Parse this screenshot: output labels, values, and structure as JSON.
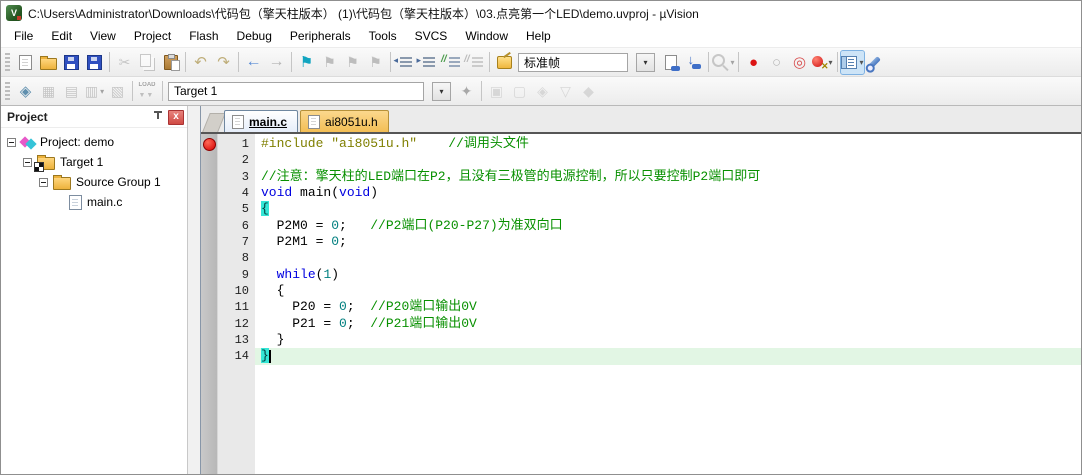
{
  "title_bar": {
    "title": "C:\\Users\\Administrator\\Downloads\\代码包（擎天柱版本） (1)\\代码包（擎天柱版本）\\03.点亮第一个LED\\demo.uvproj - µVision",
    "app_icon": "uvision-logo",
    "app_icon_text": "V"
  },
  "menu": {
    "items": [
      "File",
      "Edit",
      "View",
      "Project",
      "Flash",
      "Debug",
      "Peripherals",
      "Tools",
      "SVCS",
      "Window",
      "Help"
    ]
  },
  "colors": {
    "keyword": "#0000e0",
    "comment": "#089000",
    "preprocessor": "#7f7f00",
    "number": "#007f7f",
    "brace_match_bg": "#35e6d6",
    "current_line_bg": "#e2f6e4",
    "breakpoint_red": "#d40000",
    "inactive_tab_bg": "#f3be55"
  },
  "toolbar1": {
    "search_combo_value": "标准帧",
    "items": [
      {
        "k": "grip",
        "name": "toolbar-grip"
      },
      {
        "k": "btn",
        "name": "new-file-button",
        "shape": "page"
      },
      {
        "k": "btn",
        "name": "open-file-button",
        "shape": "folder"
      },
      {
        "k": "btn",
        "name": "save-button",
        "shape": "floppy"
      },
      {
        "k": "btn",
        "name": "save-all-button",
        "shape": "floppy floppy2"
      },
      {
        "k": "sep"
      },
      {
        "k": "btn",
        "name": "cut-button",
        "glyph": "✂",
        "color": "#9a9a9a",
        "dim": true
      },
      {
        "k": "btn",
        "name": "copy-button",
        "shape": "copy",
        "dim": true
      },
      {
        "k": "btn",
        "name": "paste-button",
        "shape": "paste"
      },
      {
        "k": "sep"
      },
      {
        "k": "btn",
        "name": "undo-button",
        "glyph": "↶",
        "color": "#bfae7a",
        "fs": 15
      },
      {
        "k": "btn",
        "name": "redo-button",
        "glyph": "↷",
        "color": "#bfae7a",
        "fs": 15
      },
      {
        "k": "sep"
      },
      {
        "k": "btn",
        "name": "navigate-back-button",
        "glyph": "←",
        "color": "#5b8dd6",
        "fs": 16
      },
      {
        "k": "btn",
        "name": "navigate-forward-button",
        "glyph": "→",
        "color": "#b5b5b5",
        "fs": 16
      },
      {
        "k": "sep"
      },
      {
        "k": "btn",
        "name": "toggle-bookmark-button",
        "glyph": "⚑",
        "color": "#12a5c0",
        "fs": 15
      },
      {
        "k": "btn",
        "name": "prev-bookmark-button",
        "glyph": "⚑",
        "color": "#bdbdbd",
        "fs": 14
      },
      {
        "k": "btn",
        "name": "next-bookmark-button",
        "glyph": "⚑",
        "color": "#bdbdbd",
        "fs": 14
      },
      {
        "k": "btn",
        "name": "clear-bookmarks-button",
        "glyph": "⚑",
        "color": "#bdbdbd",
        "fs": 14
      },
      {
        "k": "sep"
      },
      {
        "k": "btn",
        "name": "indent-button",
        "shape": "ind l"
      },
      {
        "k": "btn",
        "name": "outdent-button",
        "shape": "ind r"
      },
      {
        "k": "btn",
        "name": "comment-button",
        "shape": "com"
      },
      {
        "k": "btn",
        "name": "uncomment-button",
        "shape": "com",
        "dim": true
      },
      {
        "k": "sep"
      },
      {
        "k": "btn",
        "name": "find-settings-button",
        "shape": "findbox"
      },
      {
        "k": "combo",
        "name": "search-combobox",
        "cls": "search",
        "bind": "toolbar1.search_combo_value"
      },
      {
        "k": "arrow",
        "name": "search-combobox-dropdown"
      },
      {
        "k": "btn",
        "name": "find-in-files-button",
        "shape": "finddoc"
      },
      {
        "k": "btn",
        "name": "incremental-find-button",
        "shape": "incr"
      },
      {
        "k": "sep"
      },
      {
        "k": "btn",
        "name": "lookup-button",
        "shape": "mag",
        "dim": true,
        "arrow": true
      },
      {
        "k": "sep"
      },
      {
        "k": "btn",
        "name": "insert-breakpoint-button",
        "glyph": "●",
        "color": "#dc1414",
        "fs": 15
      },
      {
        "k": "btn",
        "name": "disable-breakpoint-button",
        "glyph": "○",
        "color": "#b8b8b8",
        "fs": 15
      },
      {
        "k": "btn",
        "name": "kill-breakpoint-button",
        "glyph": "◎",
        "color": "#d85050",
        "fs": 15
      },
      {
        "k": "btn",
        "name": "kill-all-breakpoints-button",
        "shape": "bpx",
        "arrow": true
      },
      {
        "k": "sep"
      },
      {
        "k": "btn",
        "name": "window-layout-button",
        "shape": "layout",
        "hl": true,
        "arrow": true
      },
      {
        "k": "btn",
        "name": "configure-button",
        "shape": "wrench"
      }
    ]
  },
  "toolbar2": {
    "target_combo_value": "Target 1",
    "items": [
      {
        "k": "grip",
        "name": "toolbar-grip"
      },
      {
        "k": "btn",
        "name": "translate-button",
        "glyph": "◈",
        "color": "#5f8fae",
        "fs": 15
      },
      {
        "k": "btn",
        "name": "build-button",
        "glyph": "▦",
        "color": "#9a9a9a",
        "dim": true,
        "fs": 14
      },
      {
        "k": "btn",
        "name": "rebuild-button",
        "glyph": "▤",
        "color": "#9a9a9a",
        "dim": true,
        "fs": 14
      },
      {
        "k": "btn",
        "name": "batch-build-button",
        "glyph": "▥",
        "color": "#9a9a9a",
        "dim": true,
        "fs": 14,
        "arrow": true
      },
      {
        "k": "btn",
        "name": "stop-build-button",
        "glyph": "▧",
        "color": "#9a9a9a",
        "dim": true,
        "fs": 14
      },
      {
        "k": "sep"
      },
      {
        "k": "btn",
        "name": "download-button",
        "shape": "load",
        "dim": true
      },
      {
        "k": "sep"
      },
      {
        "k": "combo",
        "name": "target-combobox",
        "cls": "target",
        "bind": "toolbar2.target_combo_value"
      },
      {
        "k": "arrow",
        "name": "target-combobox-dropdown"
      },
      {
        "k": "btn",
        "name": "target-options-button",
        "glyph": "✦",
        "color": "#a8a8a8",
        "fs": 14
      },
      {
        "k": "sep"
      },
      {
        "k": "btn",
        "name": "file-extensions-button",
        "glyph": "▣",
        "color": "#bdbdbd",
        "dim": true,
        "fs": 14
      },
      {
        "k": "btn",
        "name": "manage-windows-button",
        "glyph": "▢",
        "color": "#bdbdbd",
        "dim": true,
        "fs": 14
      },
      {
        "k": "btn",
        "name": "multi-project-button",
        "glyph": "◈",
        "color": "#bdbdbd",
        "dim": true,
        "fs": 14
      },
      {
        "k": "btn",
        "name": "funnel-button",
        "glyph": "▽",
        "color": "#bdbdbd",
        "dim": true,
        "fs": 14
      },
      {
        "k": "btn",
        "name": "pack-installer-button",
        "glyph": "◆",
        "color": "#bdbdbd",
        "dim": true,
        "fs": 14
      }
    ]
  },
  "project_panel": {
    "header": "Project",
    "tree": [
      {
        "label": "Project: demo",
        "level": 0,
        "icon": "chip",
        "expand": true
      },
      {
        "label": "Target 1",
        "level": 1,
        "icon": "folder-target",
        "expand": true
      },
      {
        "label": "Source Group 1",
        "level": 2,
        "icon": "folder",
        "expand": true
      },
      {
        "label": "main.c",
        "level": 3,
        "icon": "file",
        "expand": false
      }
    ]
  },
  "editor": {
    "tabs": [
      {
        "label": "main.c",
        "active": true
      },
      {
        "label": "ai8051u.h",
        "active": false
      }
    ],
    "lines": [
      {
        "n": 1,
        "bp": true,
        "seg": [
          [
            "pre",
            "#include"
          ],
          [
            "plain",
            " "
          ],
          [
            "str",
            "\"ai8051u.h\""
          ],
          [
            "plain",
            "    "
          ],
          [
            "com",
            "//调用头文件"
          ]
        ]
      },
      {
        "n": 2,
        "seg": []
      },
      {
        "n": 3,
        "seg": [
          [
            "com",
            "//注意：擎天柱的LED端口在P2，且没有三极管的电源控制，所以只要控制P2端口即可"
          ]
        ]
      },
      {
        "n": 4,
        "seg": [
          [
            "kw",
            "void"
          ],
          [
            "plain",
            " main("
          ],
          [
            "kw",
            "void"
          ],
          [
            "plain",
            ")"
          ]
        ]
      },
      {
        "n": 5,
        "seg": [
          [
            "bmatch",
            "{"
          ]
        ]
      },
      {
        "n": 6,
        "seg": [
          [
            "plain",
            "  P2M0 = "
          ],
          [
            "num",
            "0"
          ],
          [
            "plain",
            ";   "
          ],
          [
            "com",
            "//P2端口(P20-P27)为准双向口"
          ]
        ]
      },
      {
        "n": 7,
        "seg": [
          [
            "plain",
            "  P2M1 = "
          ],
          [
            "num",
            "0"
          ],
          [
            "plain",
            ";"
          ]
        ]
      },
      {
        "n": 8,
        "seg": []
      },
      {
        "n": 9,
        "seg": [
          [
            "plain",
            "  "
          ],
          [
            "kw",
            "while"
          ],
          [
            "plain",
            "("
          ],
          [
            "num",
            "1"
          ],
          [
            "plain",
            ")"
          ]
        ]
      },
      {
        "n": 10,
        "seg": [
          [
            "plain",
            "  {"
          ]
        ]
      },
      {
        "n": 11,
        "seg": [
          [
            "plain",
            "    P20 = "
          ],
          [
            "num",
            "0"
          ],
          [
            "plain",
            ";  "
          ],
          [
            "com",
            "//P20端口输出0V"
          ]
        ]
      },
      {
        "n": 12,
        "seg": [
          [
            "plain",
            "    P21 = "
          ],
          [
            "num",
            "0"
          ],
          [
            "plain",
            ";  "
          ],
          [
            "com",
            "//P21端口输出0V"
          ]
        ]
      },
      {
        "n": 13,
        "seg": [
          [
            "plain",
            "  }"
          ]
        ]
      },
      {
        "n": 14,
        "seg": [
          [
            "bmatch",
            "}"
          ]
        ],
        "caret": true,
        "highlight": true
      }
    ]
  }
}
